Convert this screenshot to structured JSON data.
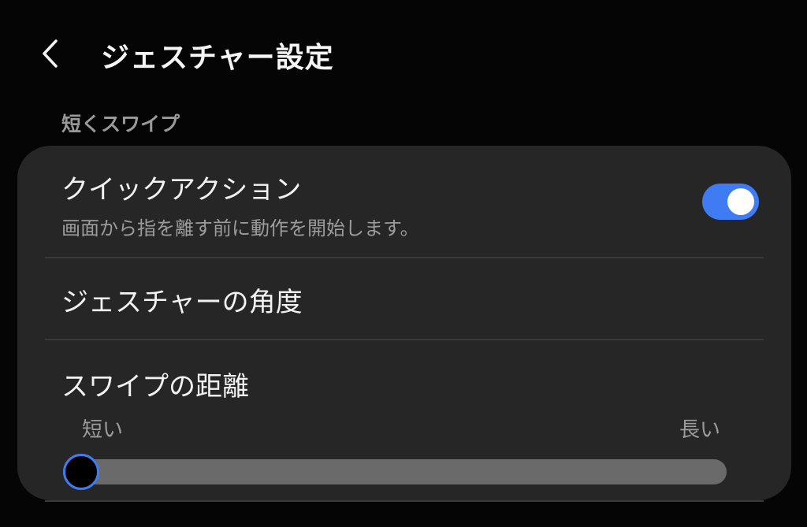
{
  "header": {
    "title": "ジェスチャー設定",
    "back_icon": "chevron-left-icon"
  },
  "section": {
    "label": "短くスワイプ"
  },
  "items": {
    "quick_action": {
      "title": "クイックアクション",
      "subtitle": "画面から指を離す前に動作を開始します。",
      "toggle_on": true
    },
    "gesture_angle": {
      "title": "ジェスチャーの角度"
    },
    "swipe_distance": {
      "title": "スワイプの距離",
      "min_label": "短い",
      "max_label": "長い",
      "value": 0
    }
  },
  "colors": {
    "background": "#050505",
    "card": "#262626",
    "accent": "#3f7cf4",
    "track": "#6a6a6a",
    "subtext": "#9c9c9c"
  }
}
